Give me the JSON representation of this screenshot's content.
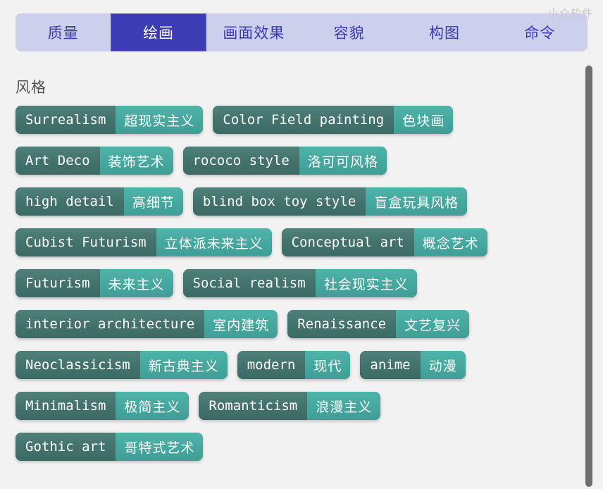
{
  "watermark": "小众软件",
  "tabs": [
    {
      "label": "质量",
      "active": false
    },
    {
      "label": "绘画",
      "active": true
    },
    {
      "label": "画面效果",
      "active": false
    },
    {
      "label": "容貌",
      "active": false
    },
    {
      "label": "构图",
      "active": false
    },
    {
      "label": "命令",
      "active": false
    }
  ],
  "section": {
    "title": "风格"
  },
  "colors": {
    "page_background": "#f2f2f2",
    "tabbar_background": "#ccd0ec",
    "tab_text": "#3a3ab4",
    "tab_active_background": "#3c3cb4",
    "tab_active_text": "#ffffff",
    "section_title": "#555555",
    "tag_english_background": "#43716c",
    "tag_chinese_background": "#45a89f",
    "tag_text": "#ffffff",
    "scrollbar_thumb": "#6e6e6e",
    "watermark": "#c9c9cf"
  },
  "tag_rows": [
    [
      {
        "en": "Surrealism",
        "zh": "超现实主义"
      },
      {
        "en": "Color Field painting",
        "zh": "色块画"
      }
    ],
    [
      {
        "en": "Art Deco",
        "zh": "装饰艺术"
      },
      {
        "en": "rococo style",
        "zh": "洛可可风格"
      }
    ],
    [
      {
        "en": "high detail",
        "zh": "高细节"
      },
      {
        "en": "blind box toy style",
        "zh": "盲盒玩具风格"
      }
    ],
    [
      {
        "en": "Cubist Futurism",
        "zh": "立体派未来主义"
      },
      {
        "en": "Conceptual art",
        "zh": "概念艺术"
      }
    ],
    [
      {
        "en": "Futurism",
        "zh": "未来主义"
      },
      {
        "en": "Social realism",
        "zh": "社会现实主义"
      }
    ],
    [
      {
        "en": "interior architecture",
        "zh": "室内建筑"
      },
      {
        "en": "Renaissance",
        "zh": "文艺复兴"
      }
    ],
    [
      {
        "en": "Neoclassicism",
        "zh": "新古典主义"
      },
      {
        "en": "modern",
        "zh": "现代"
      },
      {
        "en": "anime",
        "zh": "动漫"
      }
    ],
    [
      {
        "en": "Minimalism",
        "zh": "极简主义"
      },
      {
        "en": "Romanticism",
        "zh": "浪漫主义"
      }
    ],
    [
      {
        "en": "Gothic art",
        "zh": "哥特式艺术"
      }
    ]
  ]
}
